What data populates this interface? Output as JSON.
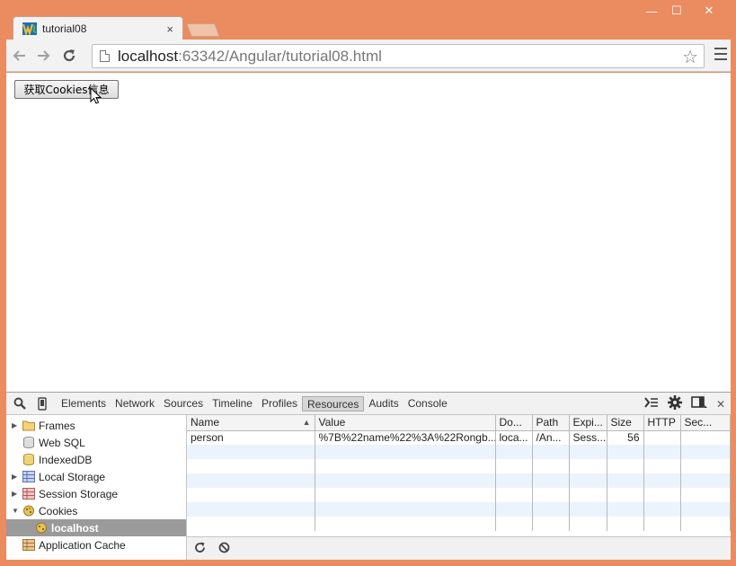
{
  "browser": {
    "tab_title": "tutorial08",
    "tab_close": "×",
    "url_host": "localhost",
    "url_rest": ":63342/Angular/tutorial08.html",
    "window_controls": {
      "minimize": "—",
      "maximize": "☐",
      "close": "✕"
    }
  },
  "page": {
    "cookie_button_label": "获取Cookies信息"
  },
  "devtools": {
    "tabs": [
      {
        "label": "Elements"
      },
      {
        "label": "Network"
      },
      {
        "label": "Sources"
      },
      {
        "label": "Timeline"
      },
      {
        "label": "Profiles"
      },
      {
        "label": "Resources"
      },
      {
        "label": "Audits"
      },
      {
        "label": "Console"
      }
    ],
    "active_tab": "Resources",
    "sidebar": [
      {
        "label": "Frames"
      },
      {
        "label": "Web SQL"
      },
      {
        "label": "IndexedDB"
      },
      {
        "label": "Local Storage"
      },
      {
        "label": "Session Storage"
      },
      {
        "label": "Cookies"
      },
      {
        "label": "localhost"
      },
      {
        "label": "Application Cache"
      }
    ],
    "columns": [
      "Name",
      "Value",
      "Do...",
      "Path",
      "Expi...",
      "Size",
      "HTTP",
      "Sec..."
    ],
    "rows": [
      {
        "name": "person",
        "value": "%7B%22name%22%3A%22Rongb...",
        "domain": "loca...",
        "path": "/An...",
        "expires": "Sess...",
        "size": "56",
        "http": "",
        "secure": ""
      }
    ]
  },
  "colors": {
    "frame": "#ea8c60",
    "stripe": "#ebf3fd",
    "selected": "#9a9a9a"
  }
}
